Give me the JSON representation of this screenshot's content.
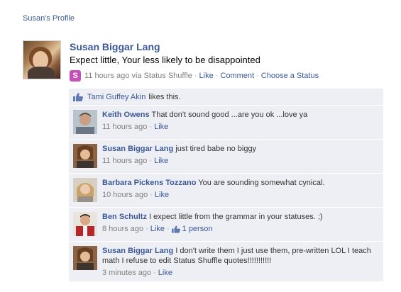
{
  "profile_link": "Susan's Profile",
  "post": {
    "author": "Susan Biggar Lang",
    "text": "Expect little, Your less likely to be disappointed",
    "time": "11 hours ago via Status Shuffle",
    "actions": [
      "Like",
      "Comment",
      "Choose a Status"
    ],
    "app_icon_letter": "S"
  },
  "likes": {
    "name": "Tami Guffey Akin",
    "suffix": "likes this."
  },
  "comments": [
    {
      "author": "Keith Owens",
      "text": "That don't sound good ...are you ok ...love ya",
      "time": "11 hours ago",
      "like": "Like"
    },
    {
      "author": "Susan Biggar Lang",
      "text": "just tired babe no biggy",
      "time": "11 hours ago",
      "like": "Like"
    },
    {
      "author": "Barbara Pickens Tozzano",
      "text": "You are sounding somewhat cynical.",
      "time": "10 hours ago",
      "like": "Like"
    },
    {
      "author": "Ben Schultz",
      "text": "I expect little from the grammar in your statuses. ;)",
      "time": "8 hours ago",
      "like": "Like",
      "like_count": "1 person"
    },
    {
      "author": "Susan Biggar Lang",
      "text": "I don't write them I just use them, pre-written LOL I teach math I refuse to edit Status Shuffle quotes!!!!!!!!!!!",
      "time": "3 minutes ago",
      "like": "Like"
    }
  ],
  "colors": {
    "link": "#3b5998",
    "feedback_bg": "#edeff4",
    "meta": "#808080",
    "app_icon": "#c74fb8"
  }
}
